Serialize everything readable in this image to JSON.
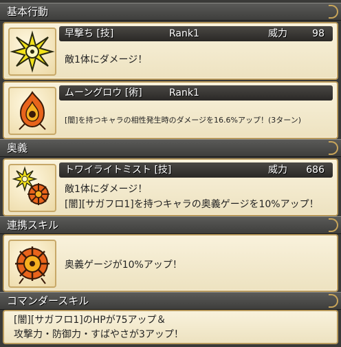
{
  "sections": {
    "basic": "基本行動",
    "ougi": "奥義",
    "renkei": "連携スキル",
    "commander": "コマンダースキル"
  },
  "skills": [
    {
      "name": "早撃ち [技]",
      "rank": "Rank1",
      "power_label": "威力",
      "power": "98",
      "desc": "敵1体にダメージ！",
      "icon": "burst-star-icon"
    },
    {
      "name": "ムーングロウ [術]",
      "rank": "Rank1",
      "desc": "[闇]を持つキャラの相性発生時のダメージを16.6%アップ！(3ターン)",
      "icon": "dark-flame-icon"
    }
  ],
  "ougi": {
    "name": "トワイライトミスト [技]",
    "power_label": "威力",
    "power": "686",
    "desc_line1": "敵1体にダメージ！",
    "desc_line2": "[闇][サガフロ1]を持つキャラの奥義ゲージを10%アップ！",
    "icon": "burst-and-sun-icon"
  },
  "renkei": {
    "desc": "奥義ゲージが10%アップ！",
    "icon": "sun-emblem-icon"
  },
  "commander": {
    "line1": "[闇][サガフロ1]のHPが75アップ＆",
    "line2": "攻撃力・防御力・すばやさが3アップ！"
  },
  "colors": {
    "card_bg": "#f3e8c8",
    "card_border": "#b99a5c",
    "header_bg": "#4a4a48",
    "title_bar": "#2e2c2a",
    "icon_yellow": "#f2e21a",
    "icon_orange": "#e8641c"
  }
}
